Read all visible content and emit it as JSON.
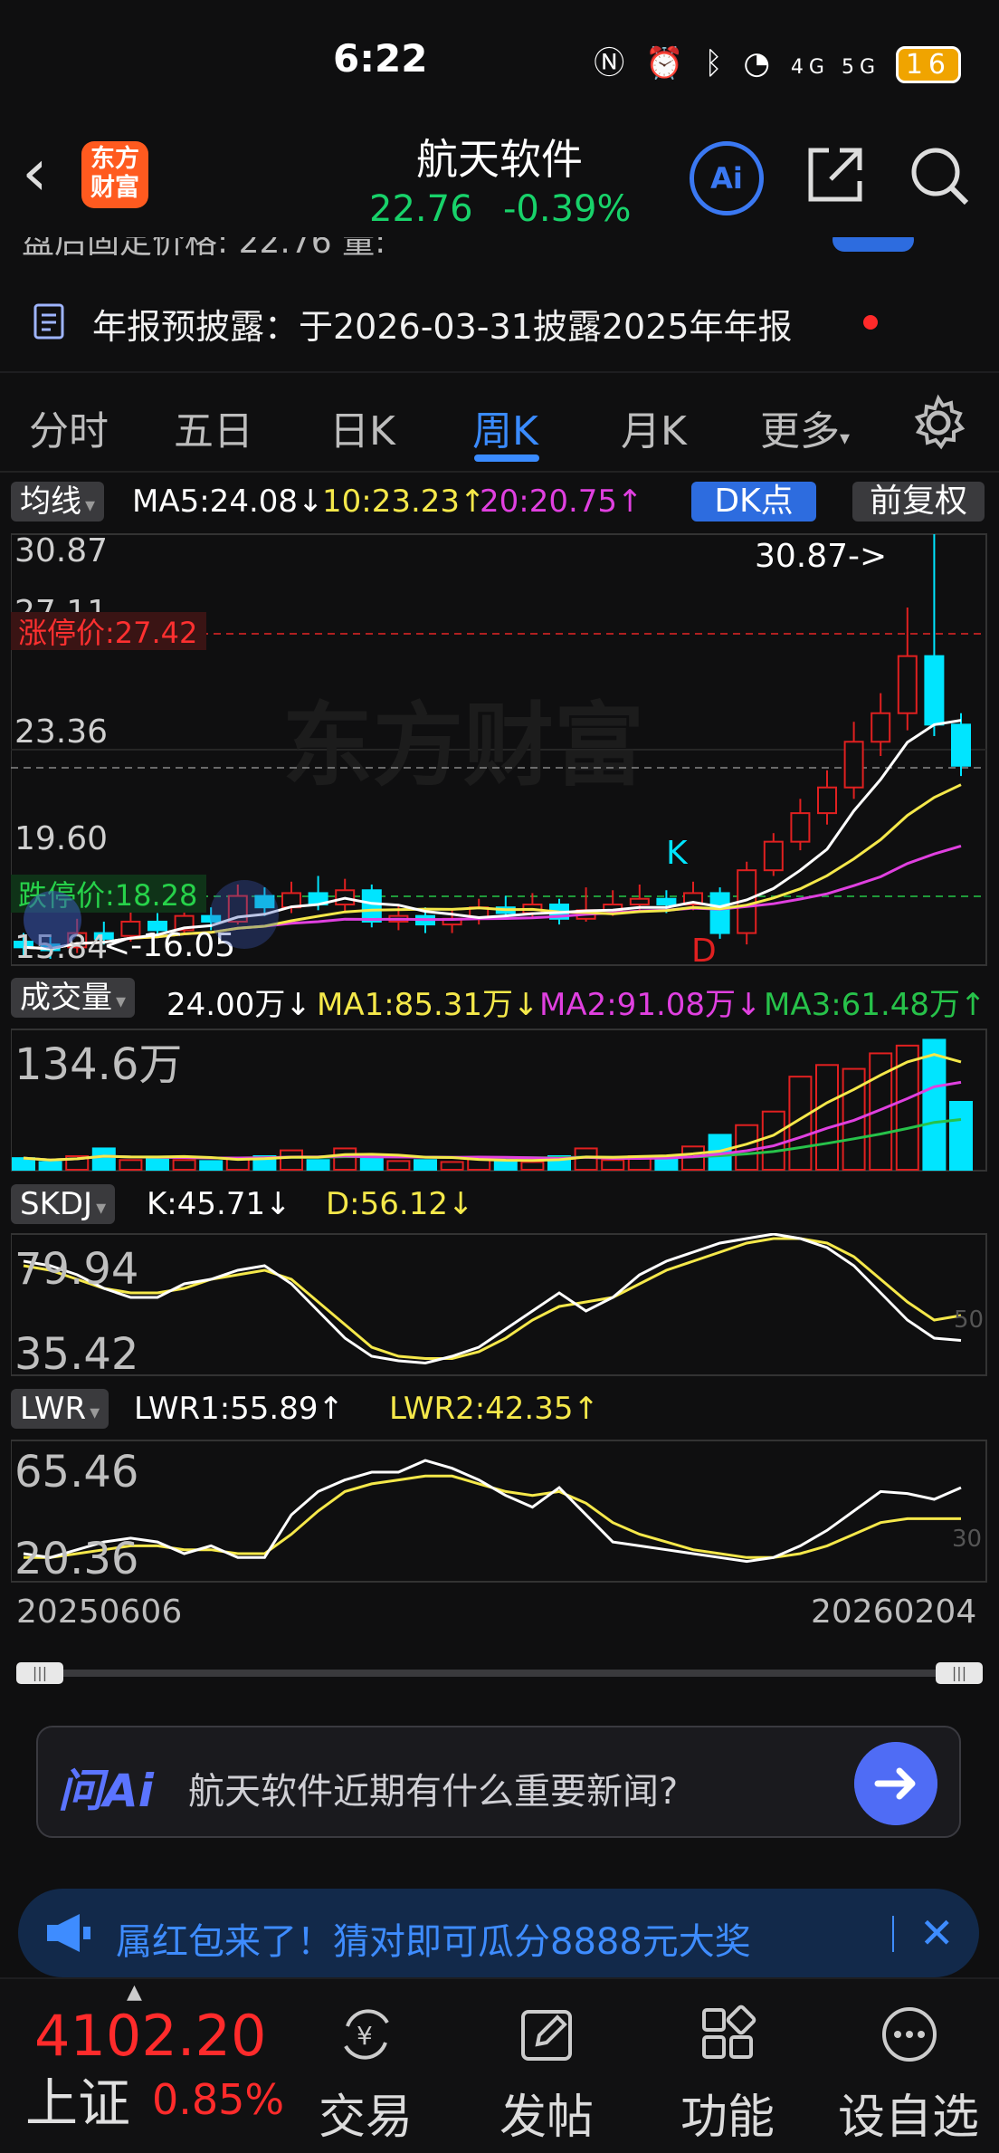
{
  "status_bar": {
    "time": "6:22",
    "signal_text": "4G 5G",
    "battery": "16"
  },
  "header": {
    "logo_text": "东方财富",
    "stock_name": "航天软件",
    "price": "22.76",
    "change": "-0.39%",
    "ai_label": "Ai"
  },
  "notice": {
    "text": "年报预披露：于2026-03-31披露2025年年报"
  },
  "tabs": [
    {
      "label": "分时",
      "active": false
    },
    {
      "label": "五日",
      "active": false
    },
    {
      "label": "日K",
      "active": false
    },
    {
      "label": "周K",
      "active": true
    },
    {
      "label": "月K",
      "active": false
    },
    {
      "label": "更多",
      "active": false
    }
  ],
  "ma_row": {
    "selector": "均线",
    "ma5": "MA5:24.08↓",
    "ma10": "10:23.23↑",
    "ma20": "20:20.75↑",
    "dk_label": "DK点",
    "adjust_label": "前复权"
  },
  "price_chart": {
    "y_labels": [
      "30.87",
      "27.11",
      "23.36",
      "19.60",
      "15.84"
    ],
    "limit_up_label": "涨停价:27.42",
    "limit_down_label": "跌停价:18.28",
    "high_annotation": "30.87->",
    "low_annotation": "<-16.05",
    "k_marker": "K",
    "d_marker": "D",
    "watermark": "东方财富",
    "colors": {
      "up": "#e02020",
      "down": "#00e5ff",
      "ma5": "#ffffff",
      "ma10": "#f5e84a",
      "ma20": "#e040e0"
    }
  },
  "vol_row": {
    "selector": "成交量",
    "vol": "24.00万↓",
    "ma1": "MA1:85.31万↓",
    "ma2": "MA2:91.08万↓",
    "ma3": "MA3:61.48万↑",
    "y_label": "134.6万"
  },
  "skdj_row": {
    "selector": "SKDJ",
    "k": "K:45.71↓",
    "d": "D:56.12↓",
    "y_labels": [
      "79.94",
      "35.42"
    ],
    "ref_label": "50"
  },
  "lwr_row": {
    "selector": "LWR",
    "lwr1": "LWR1:55.89↑",
    "lwr2": "LWR2:42.35↑",
    "y_labels": [
      "65.46",
      "20.36"
    ],
    "ref_label": "30"
  },
  "date_range": {
    "start": "20250606",
    "end": "20260204"
  },
  "ask_ai": {
    "brand": "问Ai",
    "question": "航天软件近期有什么重要新闻?"
  },
  "promo": {
    "text": "属红包来了！猜对即可瓜分8888元大奖"
  },
  "bottom_nav": {
    "index_value": "4102.20",
    "index_name": "上证",
    "index_change": "0.85%",
    "items": [
      {
        "label": "交易",
        "icon": "yen-refresh-icon"
      },
      {
        "label": "发帖",
        "icon": "edit-icon"
      },
      {
        "label": "功能",
        "icon": "grid-icon"
      },
      {
        "label": "设自选",
        "icon": "more-dots-icon"
      }
    ]
  }
}
